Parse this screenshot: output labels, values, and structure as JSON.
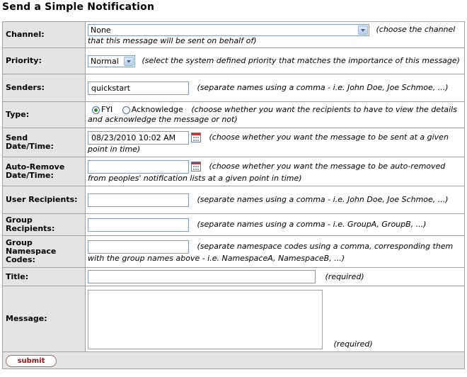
{
  "page": {
    "title": "Send a Simple Notification"
  },
  "form": {
    "channel": {
      "label": "Channel:",
      "value": "None",
      "hint": "(choose the channel that this message will be sent on behalf of)"
    },
    "priority": {
      "label": "Priority:",
      "value": "Normal",
      "hint": "(select the system defined priority that matches the importance of this message)"
    },
    "senders": {
      "label": "Senders:",
      "value": "quickstart",
      "hint": "(separate names using a comma - i.e. John Doe, Joe Schmoe, ...)"
    },
    "type": {
      "label": "Type:",
      "options": [
        "FYI",
        "Acknowledge"
      ],
      "selected": "FYI",
      "hint": "(choose whether you want the recipients to have to view the details and acknowledge the message or not)"
    },
    "send_datetime": {
      "label_line1": "Send",
      "label_line2": "Date/Time:",
      "value": "08/23/2010 10:02 AM",
      "hint": "(choose whether you want the message to be sent at a given point in time)"
    },
    "auto_remove": {
      "label_line1": "Auto-Remove",
      "label_line2": "Date/Time:",
      "value": "",
      "hint": "(choose whether you want the message to be auto-removed from peoples' notification lists at a given point in time)"
    },
    "user_recipients": {
      "label": "User Recipients:",
      "value": "",
      "hint": "(separate names using a comma - i.e. John Doe, Joe Schmoe, ...)"
    },
    "group_recipients": {
      "label_line1": "Group",
      "label_line2": "Recipients:",
      "value": "",
      "hint": "(separate names using a comma - i.e. GroupA, GroupB, ...)"
    },
    "group_namespace": {
      "label_line1": "Group",
      "label_line2": "Namespace",
      "label_line3": "Codes:",
      "value": "",
      "hint": "(separate namespace codes using a comma, corresponding them with the group names above - i.e. NamespaceA, NamespaceB, ...)"
    },
    "title": {
      "label": "Title:",
      "value": "",
      "hint": "(required)"
    },
    "message": {
      "label": "Message:",
      "value": "",
      "hint": "(required)"
    }
  },
  "actions": {
    "submit_label": "submit"
  },
  "colors": {
    "label_bg": "#e4e4e4",
    "border": "#a0a0a0",
    "submit_text": "#a01010",
    "radio_dot": "#2d8a2d"
  },
  "icons": [
    "dropdown-arrow-icon",
    "calendar-icon",
    "radio-icon"
  ]
}
